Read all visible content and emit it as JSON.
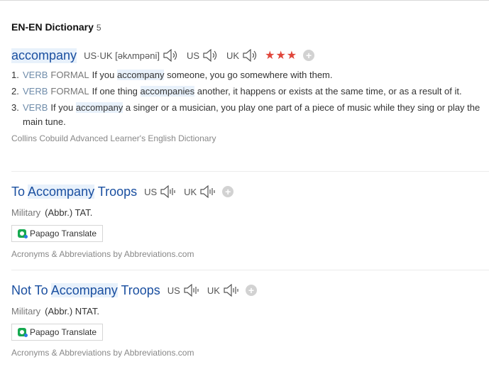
{
  "section": {
    "title": "EN-EN Dictionary",
    "count": "5"
  },
  "entries": [
    {
      "headword": "accompany",
      "pron_labels": [
        "US·UK [əkʌmpəni]",
        "US",
        "UK"
      ],
      "rating": "★★★",
      "plus": "+",
      "senses": [
        {
          "num": "1.",
          "pos": "VERB",
          "reg": "FORMAL",
          "pre": "If you ",
          "hl": "accompany",
          "post": " someone, you go somewhere with them."
        },
        {
          "num": "2.",
          "pos": "VERB",
          "reg": "FORMAL",
          "pre": "If one thing ",
          "hl": "accompanies",
          "post": " another, it happens or exists at the same time, or as a result of it."
        },
        {
          "num": "3.",
          "pos": "VERB",
          "reg": "",
          "pre": "If you ",
          "hl": "accompany",
          "post": " a singer or a musician, you play one part of a piece of music while they sing or play the main tune."
        }
      ],
      "source": "Collins Cobuild Advanced Learner's English Dictionary"
    },
    {
      "headword_pre": "To ",
      "headword_hl": "Accompany",
      "headword_post": " Troops",
      "pron_labels": [
        "US",
        "UK"
      ],
      "plus": "+",
      "category": "Military",
      "abbr": "(Abbr.) TAT.",
      "papago": "Papago Translate",
      "source": "Acronyms & Abbreviations by Abbreviations.com"
    },
    {
      "headword_pre": "Not To ",
      "headword_hl": "Accompany",
      "headword_post": " Troops",
      "pron_labels": [
        "US",
        "UK"
      ],
      "plus": "+",
      "category": "Military",
      "abbr": "(Abbr.) NTAT.",
      "papago": "Papago Translate",
      "source": "Acronyms & Abbreviations by Abbreviations.com"
    }
  ],
  "colors": {
    "headword": "#1a4fa0",
    "highlight": "#e8f1fb",
    "stars": "#e0463b",
    "pos": "#6f8caa",
    "papago_green": "#16a950"
  },
  "icons": [
    "speaker-icon",
    "plus-icon",
    "star-icon",
    "papago-icon"
  ]
}
